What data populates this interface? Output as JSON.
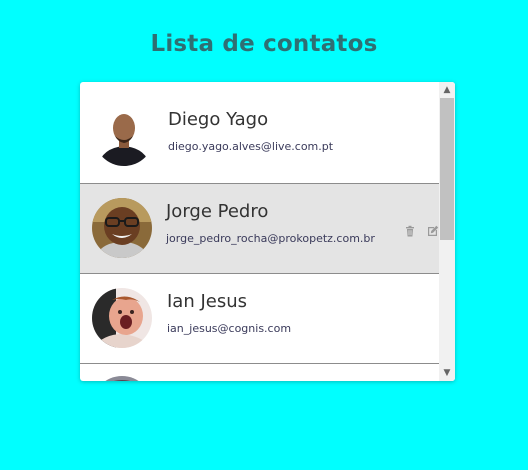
{
  "header": {
    "title": "Lista de contatos"
  },
  "contacts": [
    {
      "name": "Diego Yago",
      "email": "diego.yago.alves@live.com.pt"
    },
    {
      "name": "Jorge Pedro",
      "email": "jorge_pedro_rocha@prokopetz.com.br"
    },
    {
      "name": "Ian Jesus",
      "email": "ian_jesus@cognis.com"
    }
  ],
  "icons": {
    "delete": "trash-icon",
    "edit": "edit-icon"
  },
  "colors": {
    "background": "#00ffff",
    "title": "#2f6f73",
    "selected_row": "#e4e4e4"
  }
}
